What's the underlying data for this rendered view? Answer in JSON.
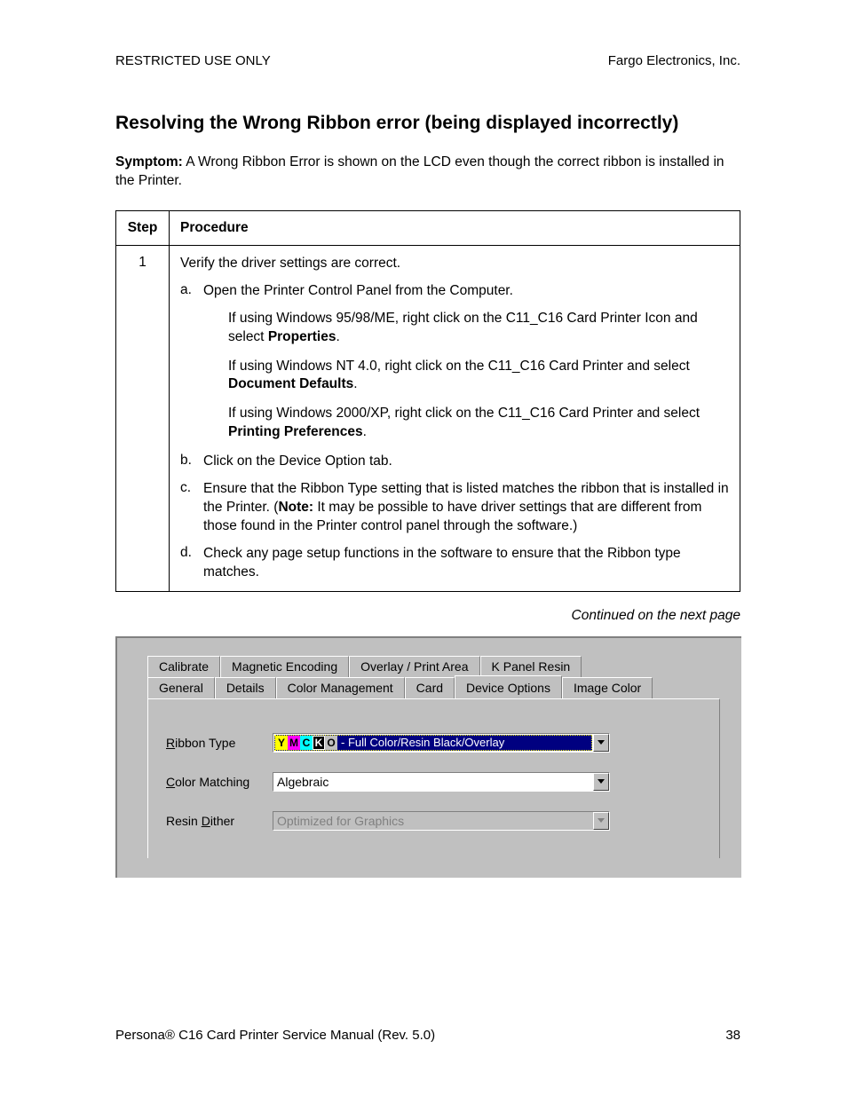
{
  "header": {
    "left": "RESTRICTED USE ONLY",
    "right": "Fargo Electronics, Inc."
  },
  "title": "Resolving the Wrong Ribbon error (being displayed incorrectly)",
  "symptom_label": "Symptom:",
  "symptom_text": "  A Wrong Ribbon Error is shown on the LCD even though the correct ribbon is installed in the Printer.",
  "table": {
    "col_step": "Step",
    "col_proc": "Procedure",
    "step_num": "1",
    "intro": "Verify the driver settings are correct.",
    "a_label": "a.",
    "a_text": "Open the Printer Control Panel from the Computer.",
    "sub1_a": "If using Windows 95/98/ME, right click on the C11_C16 Card Printer Icon and select ",
    "sub1_b": "Properties",
    "sub1_c": ".",
    "sub2_a": "If using Windows NT 4.0, right click on the C11_C16 Card Printer and select ",
    "sub2_b": "Document Defaults",
    "sub2_c": ".",
    "sub3_a": "If using Windows 2000/XP, right click on the C11_C16 Card Printer and select ",
    "sub3_b": "Printing Preferences",
    "sub3_c": ".",
    "b_label": "b.",
    "b_text": "Click on the Device Option tab.",
    "c_label": "c.",
    "c_text_a": "Ensure that the Ribbon Type setting that is listed matches the ribbon that is installed in the Printer. (",
    "c_text_b": "Note:",
    "c_text_c": "  It may be possible to have driver settings that are different from those found in the Printer control panel through the software.)",
    "d_label": "d.",
    "d_text": "Check any page setup functions in the software to ensure that the Ribbon type matches."
  },
  "continued": "Continued on the next page",
  "dialog": {
    "tabs_back": [
      "Calibrate",
      "Magnetic Encoding",
      "Overlay / Print Area",
      "K Panel Resin"
    ],
    "tabs_front": [
      "General",
      "Details",
      "Color Management",
      "Card",
      "Device Options",
      "Image Color"
    ],
    "ribbon_label_pre": "R",
    "ribbon_label_rest": "ibbon Type",
    "ribbon_value": " - Full Color/Resin Black/Overlay",
    "color_label_pre": "C",
    "color_label_rest": "olor Matching",
    "color_value": "Algebraic",
    "dither_label_pre": "Resin ",
    "dither_label_und": "D",
    "dither_label_rest": "ither",
    "dither_value": "Optimized for Graphics"
  },
  "footer": {
    "left_a": "Persona",
    "left_b": " C16 Card Printer Service Manual (Rev. 5.0)",
    "page": "38"
  }
}
